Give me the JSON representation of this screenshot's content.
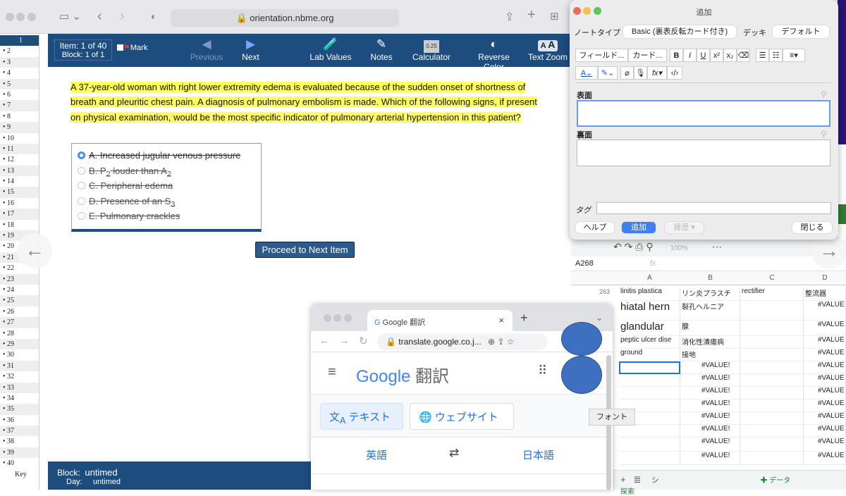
{
  "browser": {
    "url": "orientation.nbme.org"
  },
  "sidebar": {
    "items": [
      "1",
      "2",
      "3",
      "4",
      "5",
      "6",
      "7",
      "8",
      "9",
      "10",
      "11",
      "12",
      "13",
      "14",
      "15",
      "16",
      "17",
      "18",
      "19",
      "20",
      "21",
      "22",
      "23",
      "24",
      "25",
      "26",
      "27",
      "28",
      "29",
      "30",
      "31",
      "32",
      "33",
      "34",
      "35",
      "36",
      "37",
      "38",
      "39",
      "40"
    ],
    "key_label": "Key",
    "selected": "1"
  },
  "exam_header": {
    "item": "Item: 1 of 40",
    "block": "Block: 1 of 1",
    "mark": "Mark",
    "previous": "Previous",
    "next": "Next",
    "lab_values": "Lab Values",
    "notes": "Notes",
    "calculator": "Calculator",
    "calculator_display": "0.25",
    "reverse_color": "Reverse Color",
    "text_zoom": "Text Zoom",
    "text_zoom_a": "A"
  },
  "question": {
    "text": "A 37-year-old woman with right lower extremity edema is evaluated because of the sudden onset of shortness of breath and pleuritic chest pain. A diagnosis of pulmonary embolism is made. Which of the following signs, if present on physical examination, would be the most specific indicator of pulmonary arterial hypertension in this patient?",
    "highlight_color": "#ffff5a",
    "answers": [
      {
        "pre": "A. Increased jugular venous pressure"
      },
      {
        "pre": "B. P",
        "sub1": "2",
        "mid": " louder than A",
        "sub2": "2"
      },
      {
        "pre": "C. Peripheral edema"
      },
      {
        "pre": "D. Presence of an S",
        "sub1": "3"
      },
      {
        "pre": "E. Pulmonary crackles"
      }
    ],
    "selected": "A"
  },
  "proceed_label": "Proceed to Next Item",
  "exam_footer": {
    "block_label": "Block:",
    "block_value": "untimed",
    "day_label": "Day:",
    "day_value": "untimed"
  },
  "anki": {
    "title": "追加",
    "note_type_label": "ノートタイプ",
    "note_type": "Basic (裏表反転カード付き)",
    "deck_label": "デッキ",
    "deck": "デフォルト",
    "fields_btn": "フィールド...",
    "cards_btn": "カード...",
    "front_label": "表面",
    "back_label": "裏面",
    "tags_label": "タグ",
    "help": "ヘルプ",
    "add": "追加",
    "history": "履歴 ▾",
    "close": "閉じる"
  },
  "sheet": {
    "zoom": "100%",
    "cell_ref": "A268",
    "fx": "fx",
    "columns": [
      "A",
      "B",
      "C",
      "D"
    ],
    "row_number": "263",
    "rows": [
      [
        "linitis plastica",
        "リン炎プラスチ",
        "rectifier",
        "整流器"
      ],
      [
        "hiatal hern",
        "裂孔ヘルニア",
        "",
        "#VALUE"
      ],
      [
        "glandular",
        "腺",
        "",
        "#VALUE"
      ],
      [
        "peptic ulcer dise",
        "消化性潰瘍病",
        "",
        "#VALUE"
      ],
      [
        "ground",
        "接地",
        "",
        "#VALUE"
      ],
      [
        "",
        "#VALUE!",
        "",
        "#VALUE"
      ],
      [
        "",
        "#VALUE!",
        "",
        "#VALUE"
      ],
      [
        "",
        "#VALUE!",
        "",
        "#VALUE"
      ],
      [
        "",
        "#VALUE!",
        "",
        "#VALUE"
      ],
      [
        "",
        "#VALUE!",
        "",
        "#VALUE"
      ],
      [
        "",
        "#VALUE!",
        "",
        "#VALUE"
      ],
      [
        "",
        "#VALUE!",
        "",
        "#VALUE"
      ],
      [
        "",
        "#VALUE!",
        "",
        "#VALUE"
      ]
    ],
    "sheet_tab": "シ",
    "explore": "データ探索"
  },
  "translate": {
    "tab_title": "Google 翻訳",
    "url": "translate.google.co.j...",
    "logo": "Google",
    "logo_suffix": "翻訳",
    "text_tab": "テキスト",
    "website_tab": "ウェブサイト",
    "source_lang": "英語",
    "target_lang": "日本語"
  },
  "tooltip": "フォント"
}
